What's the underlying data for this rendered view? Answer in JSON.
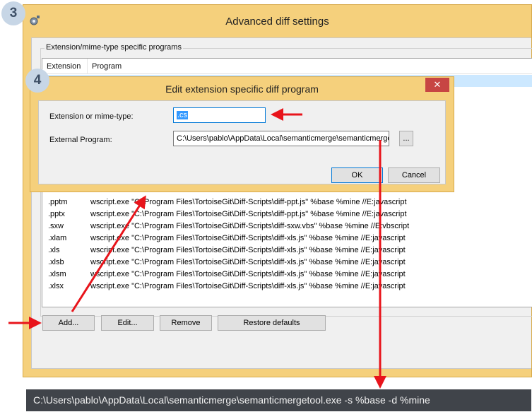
{
  "badges": {
    "outer": "3",
    "inner": "4"
  },
  "outer_window": {
    "title": "Advanced diff settings",
    "group_label": "Extension/mime-type specific programs",
    "columns": {
      "extension": "Extension",
      "program": "Program"
    },
    "rows": [
      {
        "ext": ".pptm",
        "prog": "wscript.exe \"C:\\Program Files\\TortoiseGit\\Diff-Scripts\\diff-ppt.js\" %base %mine //E:javascript"
      },
      {
        "ext": ".pptx",
        "prog": "wscript.exe \"C:\\Program Files\\TortoiseGit\\Diff-Scripts\\diff-ppt.js\" %base %mine //E:javascript"
      },
      {
        "ext": ".sxw",
        "prog": "wscript.exe \"C:\\Program Files\\TortoiseGit\\Diff-Scripts\\diff-sxw.vbs\" %base %mine //E:vbscript"
      },
      {
        "ext": ".xlam",
        "prog": "wscript.exe \"C:\\Program Files\\TortoiseGit\\Diff-Scripts\\diff-xls.js\" %base %mine //E:javascript"
      },
      {
        "ext": ".xls",
        "prog": "wscript.exe \"C:\\Program Files\\TortoiseGit\\Diff-Scripts\\diff-xls.js\" %base %mine //E:javascript"
      },
      {
        "ext": ".xlsb",
        "prog": "wscript.exe \"C:\\Program Files\\TortoiseGit\\Diff-Scripts\\diff-xls.js\" %base %mine //E:javascript"
      },
      {
        "ext": ".xlsm",
        "prog": "wscript.exe \"C:\\Program Files\\TortoiseGit\\Diff-Scripts\\diff-xls.js\" %base %mine //E:javascript"
      },
      {
        "ext": ".xlsx",
        "prog": "wscript.exe \"C:\\Program Files\\TortoiseGit\\Diff-Scripts\\diff-xls.js\" %base %mine //E:javascript"
      }
    ],
    "buttons": {
      "add": "Add...",
      "edit": "Edit...",
      "remove": "Remove",
      "restore": "Restore defaults"
    }
  },
  "inner_dialog": {
    "title": "Edit extension specific diff program",
    "close": "✕",
    "ext_label": "Extension or mime-type:",
    "ext_value": ".cs",
    "prog_label": "External Program:",
    "prog_value": "C:\\Users\\pablo\\AppData\\Local\\semanticmerge\\semanticmerge",
    "browse": "...",
    "ok": "OK",
    "cancel": "Cancel"
  },
  "command_line": "C:\\Users\\pablo\\AppData\\Local\\semanticmerge\\semanticmergetool.exe -s %base -d %mine",
  "colors": {
    "window_frame": "#f5d07c",
    "close_button": "#c74543",
    "arrow": "#e8141b",
    "badge": "#c7d6e6",
    "command_bar": "#40444a",
    "selection": "#3399ff"
  }
}
